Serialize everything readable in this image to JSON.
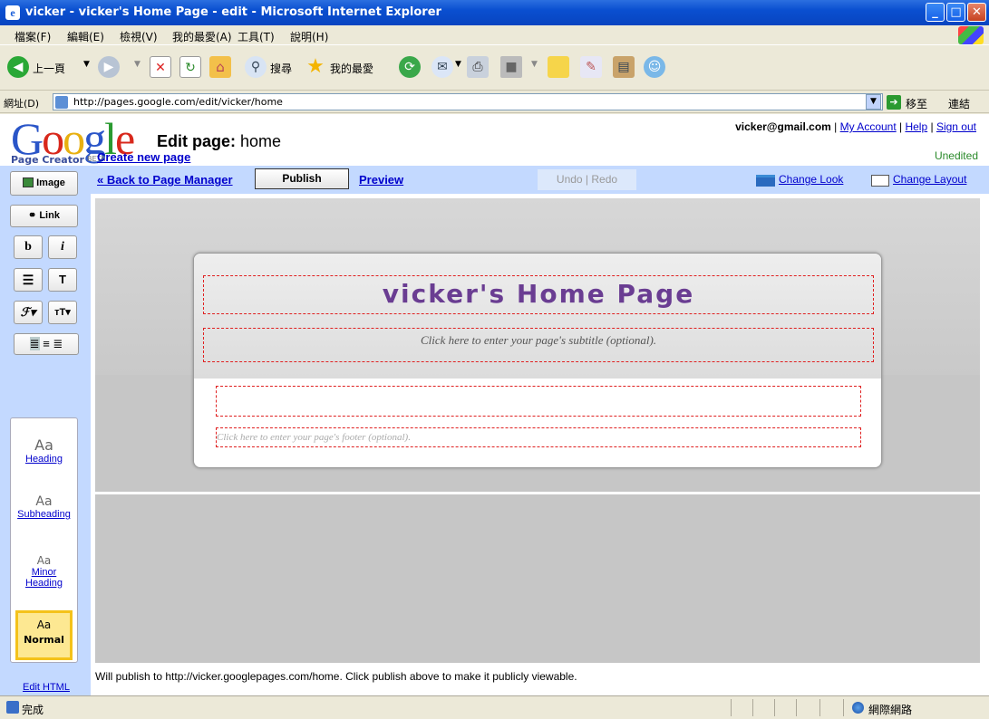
{
  "window": {
    "title": "vicker - vicker's Home Page - edit - Microsoft Internet Explorer",
    "min_label": "_",
    "max_label": "□",
    "close_label": "✕"
  },
  "menu": [
    "檔案(F)",
    "編輯(E)",
    "檢視(V)",
    "我的最愛(A)",
    "工具(T)",
    "說明(H)"
  ],
  "toolbar": {
    "back_label": "上一頁",
    "search_label": "搜尋",
    "favorites_label": "我的最愛"
  },
  "addressbar": {
    "label": "網址(D)",
    "url": "http://pages.google.com/edit/vicker/home",
    "go_label": "移至",
    "links_label": "連結"
  },
  "header": {
    "logo_text": "Google",
    "logo_sub": "Page Creator",
    "logo_beta": "BETA",
    "edit_prefix": "Edit page:",
    "page_name": "home",
    "account_email": "vicker@gmail.com",
    "my_account": "My Account",
    "help": "Help",
    "sign_out": "Sign out",
    "create_new_page": "Create new page",
    "status": "Unedited"
  },
  "editbar": {
    "back": "« Back to Page Manager",
    "publish": "Publish",
    "preview": "Preview",
    "undo": "Undo",
    "redo": "Redo",
    "change_look": "Change Look",
    "change_layout": "Change Layout"
  },
  "sidebar": {
    "image": "Image",
    "link": "Link",
    "bold": "b",
    "italic": "i",
    "styles": {
      "sample": "Aa",
      "heading": "Heading",
      "subheading": "Subheading",
      "minor_heading": "Minor Heading",
      "normal": "Normal"
    },
    "edit_html": "Edit HTML"
  },
  "canvas": {
    "site_title": "vicker's Home Page",
    "subtitle_placeholder": "Click here to enter your page's subtitle (optional).",
    "footer_placeholder": "Click here to enter your page's footer (optional)."
  },
  "publish_note": "Will publish to http://vicker.googlepages.com/home. Click publish above to make it publicly viewable.",
  "statusbar": {
    "status": "完成",
    "zone": "網際網路"
  }
}
